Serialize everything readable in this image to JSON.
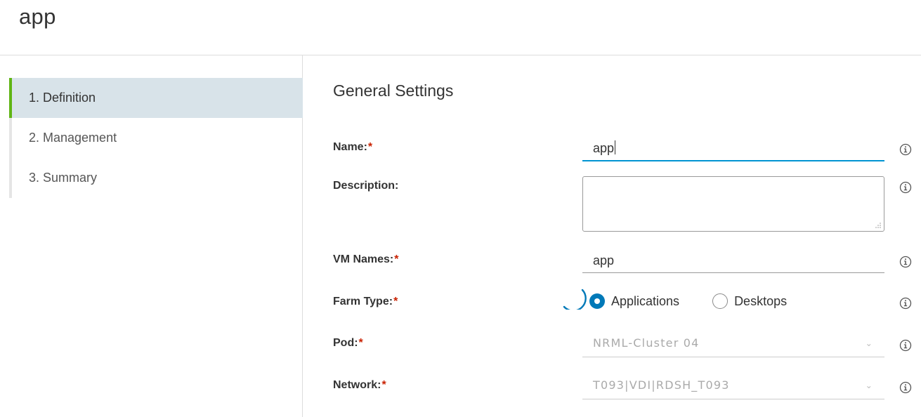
{
  "header": {
    "title": "app"
  },
  "sidebar": {
    "steps": [
      {
        "label": "1. Definition",
        "active": true
      },
      {
        "label": "2. Management",
        "active": false
      },
      {
        "label": "3. Summary",
        "active": false
      }
    ]
  },
  "main": {
    "section_title": "General Settings",
    "required_marker": "*",
    "fields": {
      "name": {
        "label": "Name:",
        "value": "app"
      },
      "description": {
        "label": "Description:",
        "value": ""
      },
      "vm_names": {
        "label": "VM Names:",
        "value": "app"
      },
      "farm_type": {
        "label": "Farm Type:",
        "options": [
          "Applications",
          "Desktops"
        ],
        "selected": "Applications"
      },
      "pod": {
        "label": "Pod:",
        "value": "NRML-Cluster 04"
      },
      "network": {
        "label": "Network:",
        "value": "T093|VDI|RDSH_T093"
      }
    }
  },
  "colors": {
    "accent": "#0094d2",
    "radio_selected": "#0079b8",
    "active_step_bar": "#60b515",
    "active_step_bg": "#d8e3e9",
    "required": "#c92100"
  },
  "icons": [
    "info-icon",
    "chevron-down-icon",
    "loading-spinner-icon",
    "resize-grip-icon"
  ]
}
